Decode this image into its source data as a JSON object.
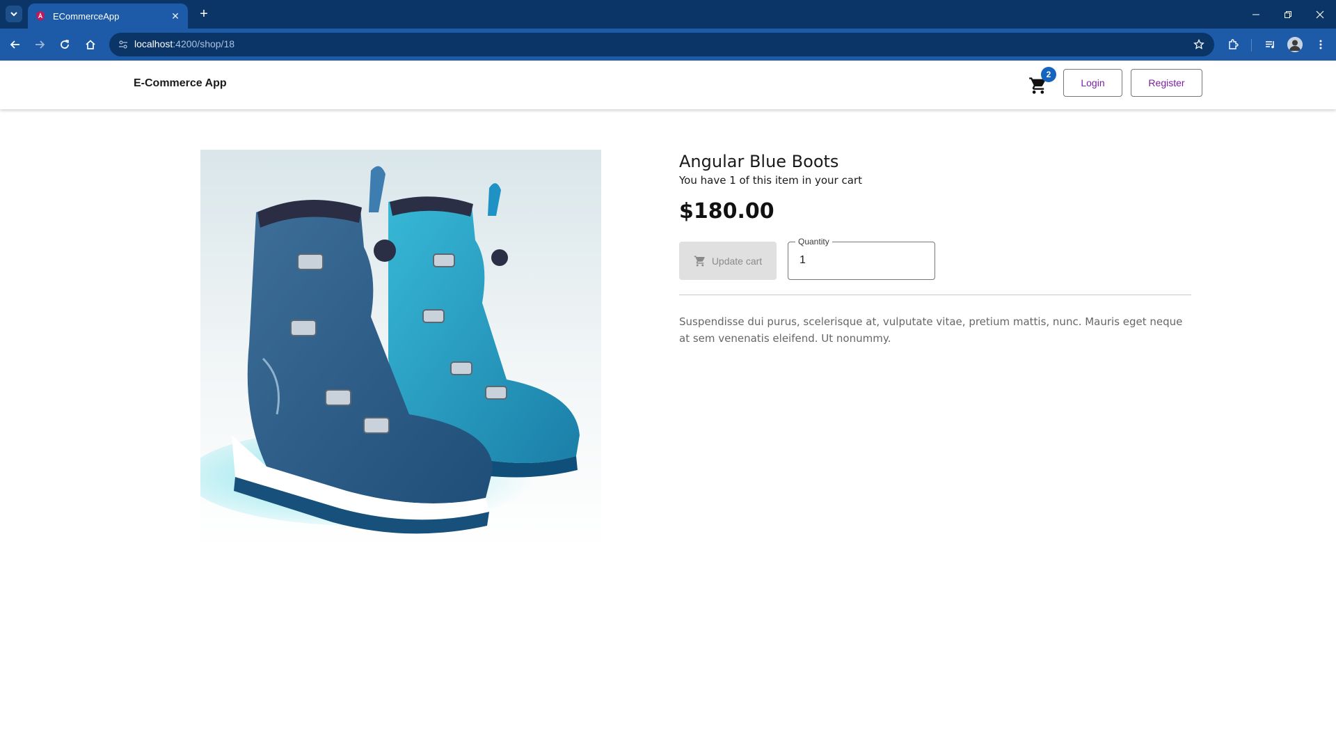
{
  "browser": {
    "tab_title": "ECommerceApp",
    "url_host": "localhost",
    "url_path": ":4200/shop/18",
    "icons": [
      "tab-search-icon",
      "favicon",
      "close-icon",
      "plus-icon",
      "back-arrow-icon",
      "forward-arrow-icon",
      "reload-icon",
      "home-icon",
      "site-info-icon",
      "star-icon",
      "extensions-icon",
      "media-icon",
      "profile-avatar",
      "kebab-menu-icon",
      "minimize-icon",
      "restore-icon",
      "close-window-icon"
    ]
  },
  "header": {
    "brand": "E-Commerce App",
    "cart_count": "2",
    "login_label": "Login",
    "register_label": "Register"
  },
  "product": {
    "title": "Angular Blue Boots",
    "cart_note": "You have 1 of this item in your cart",
    "price": "$180.00",
    "update_label": "Update cart",
    "quantity_label": "Quantity",
    "quantity_value": "1",
    "description": "Suspendisse dui purus, scelerisque at, vulputate vitae, pretium mattis, nunc. Mauris eget neque at sem venenatis eleifend. Ut nonummy."
  },
  "colors": {
    "tabstrip": "#0b3566",
    "toolbar": "#1d5aa8",
    "accent_purple": "#7b1fa2",
    "badge_blue": "#1565c0",
    "boot_blue": "#2e6a9a",
    "boot_cyan": "#21b6d6"
  }
}
